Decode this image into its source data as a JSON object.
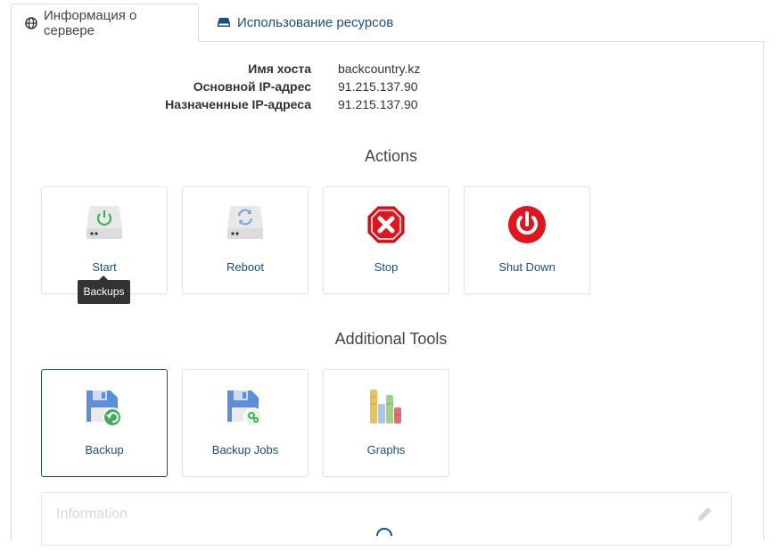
{
  "tabs": [
    {
      "label": "Информация о сервере",
      "icon": "globe-icon",
      "active": true
    },
    {
      "label": "Использование ресурсов",
      "icon": "hdd-icon",
      "active": false
    }
  ],
  "server_info": [
    {
      "key": "Имя хоста",
      "value": "backcountry.kz"
    },
    {
      "key": "Основной IP-адрес",
      "value": "91.215.137.90"
    },
    {
      "key": "Назначенные IP-адреса",
      "value": "91.215.137.90"
    }
  ],
  "actions": {
    "title": "Actions",
    "items": [
      {
        "label": "Start",
        "icon": "server-power-icon"
      },
      {
        "label": "Reboot",
        "icon": "server-reboot-icon"
      },
      {
        "label": "Stop",
        "icon": "stop-octagon-icon"
      },
      {
        "label": "Shut Down",
        "icon": "power-button-icon"
      }
    ]
  },
  "tooltip": {
    "text": "Backups"
  },
  "tools": {
    "title": "Additional Tools",
    "items": [
      {
        "label": "Backup",
        "icon": "floppy-restore-icon"
      },
      {
        "label": "Backup Jobs",
        "icon": "floppy-gear-icon"
      },
      {
        "label": "Graphs",
        "icon": "bar-stack-icon"
      }
    ]
  },
  "info_card": {
    "title": "Information"
  },
  "colors": {
    "link": "#1d4d7c",
    "stop_red": "#e0151f",
    "power_red": "#e0151f",
    "green": "#3fae5a",
    "blue_floppy": "#5b8fd9"
  }
}
